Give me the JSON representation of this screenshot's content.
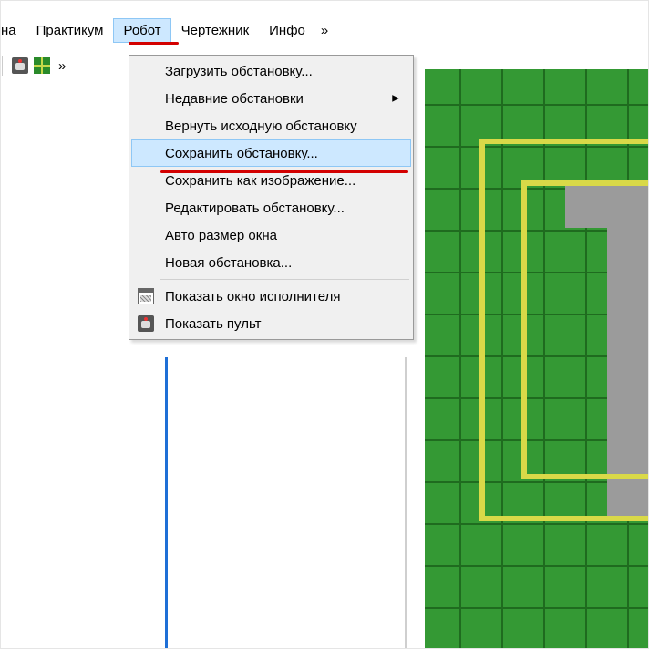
{
  "menubar": {
    "partial": "на",
    "items": [
      "Практикум",
      "Робот",
      "Чертежник",
      "Инфо"
    ],
    "more": "»",
    "active_index": 1
  },
  "toolbar": {
    "more": "»"
  },
  "dropdown": {
    "items": [
      {
        "label": "Загрузить обстановку...",
        "submenu": false
      },
      {
        "label": "Недавние обстановки",
        "submenu": true
      },
      {
        "label": "Вернуть исходную обстановку",
        "submenu": false
      },
      {
        "label": "Сохранить обстановку...",
        "submenu": false,
        "highlighted": true
      },
      {
        "label": "Сохранить как изображение...",
        "submenu": false
      },
      {
        "label": "Редактировать обстановку...",
        "submenu": false
      },
      {
        "label": "Авто размер окна",
        "submenu": false
      },
      {
        "label": "Новая обстановка...",
        "submenu": false
      }
    ],
    "footer": [
      {
        "label": "Показать окно исполнителя",
        "icon": "window-icon"
      },
      {
        "label": "Показать пульт",
        "icon": "joystick-icon"
      }
    ],
    "arrow_glyph": "▶"
  }
}
